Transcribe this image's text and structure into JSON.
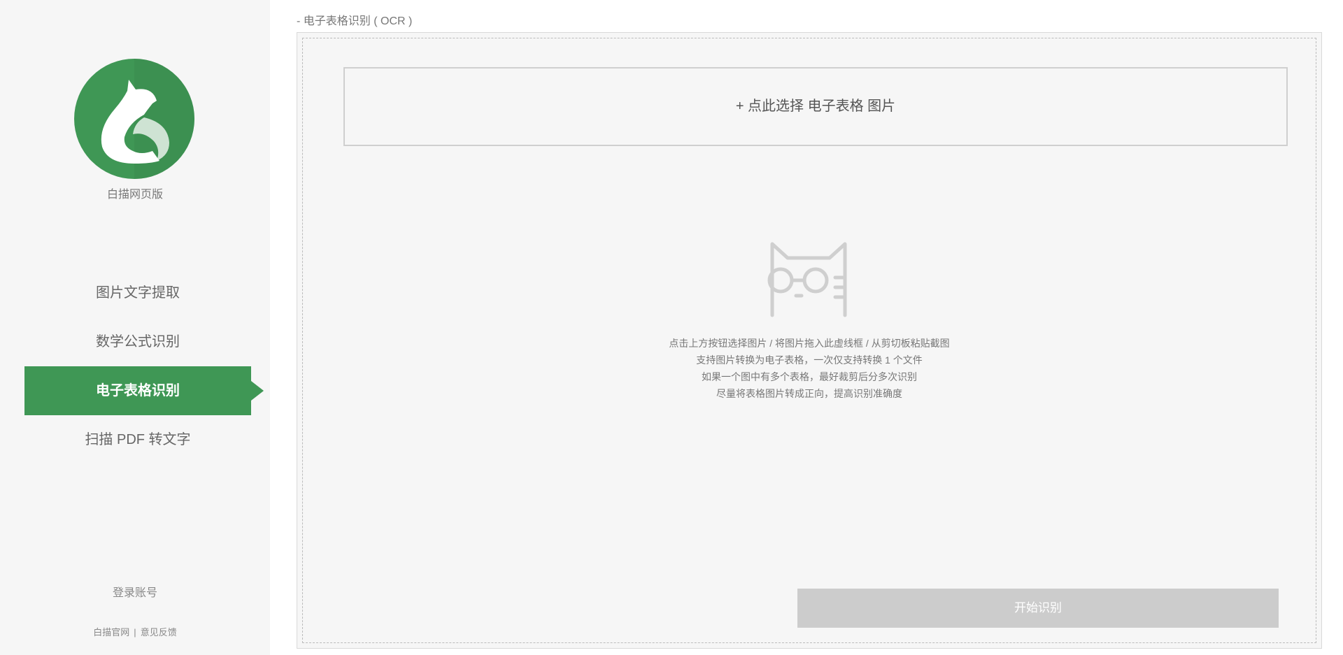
{
  "app": {
    "name": "白描网页版"
  },
  "nav": {
    "items": [
      {
        "label": "图片文字提取",
        "active": false
      },
      {
        "label": "数学公式识别",
        "active": false
      },
      {
        "label": "电子表格识别",
        "active": true
      },
      {
        "label": "扫描 PDF 转文字",
        "active": false
      }
    ]
  },
  "account": {
    "login_label": "登录账号"
  },
  "footer": {
    "official_site": "白描官网",
    "separator": "|",
    "feedback": "意见反馈"
  },
  "main": {
    "breadcrumb": "- 电子表格识别 ( OCR )",
    "select_button_label": "+ 点此选择 电子表格 图片",
    "hints": [
      "点击上方按钮选择图片 / 将图片拖入此虚线框 / 从剪切板粘贴截图",
      "支持图片转换为电子表格，一次仅支持转换 1 个文件",
      "如果一个图中有多个表格，最好裁剪后分多次识别",
      "尽量将表格图片转成正向，提高识别准确度"
    ],
    "start_button_label": "开始识别"
  },
  "icons": {
    "logo": "cat-logo-icon",
    "placeholder": "cat-with-glasses-icon"
  },
  "colors": {
    "brand_green": "#3f9755",
    "sidebar_bg": "#f6f6f6",
    "button_disabled": "#cccccc"
  }
}
